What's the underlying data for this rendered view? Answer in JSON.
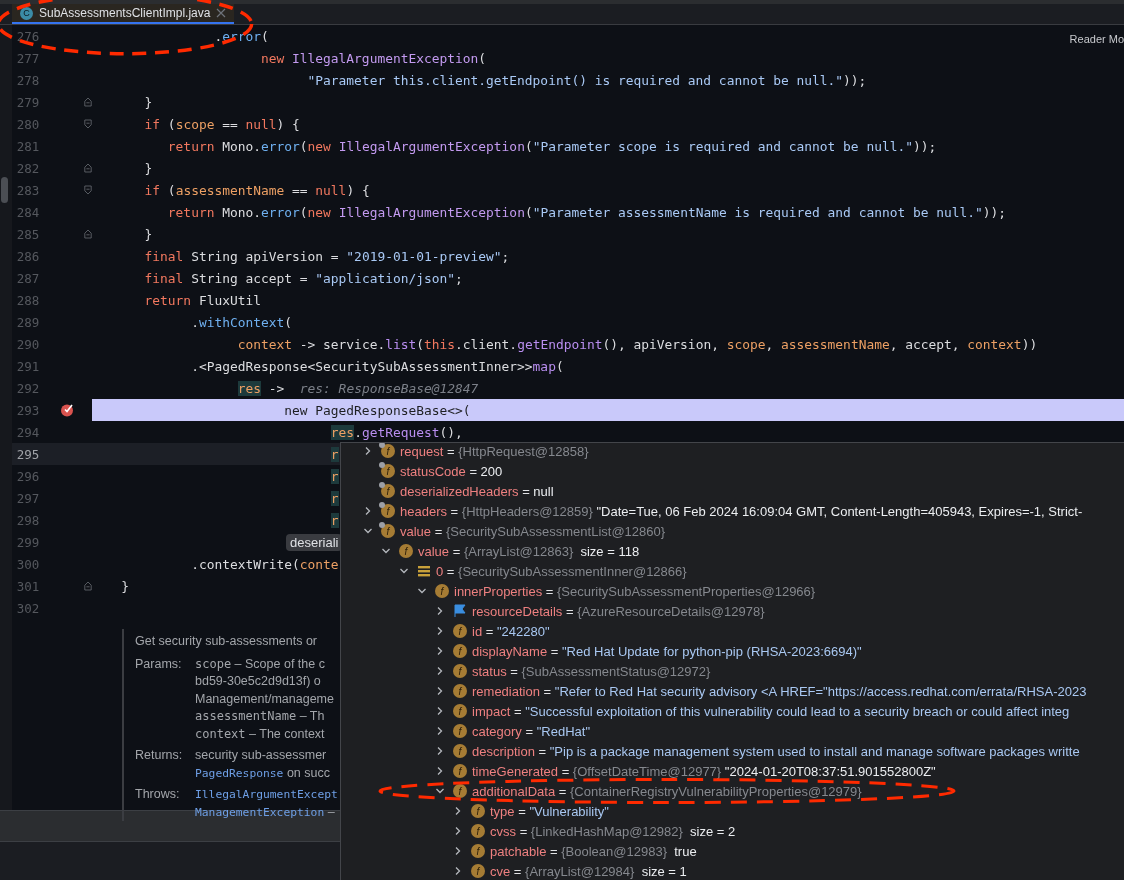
{
  "tab": {
    "label": "SubAssessmentsClientImpl.java",
    "icon": "C",
    "selected": true,
    "circled": true
  },
  "reader_mode": "Reader Mo",
  "lines": [
    {
      "n": "276",
      "kind": "plain",
      "tokens": [
        {
          "t": "               ."
        },
        {
          "t": "error",
          "kind": "fn"
        },
        {
          "t": "("
        }
      ],
      "breakpoint": false,
      "execution": false,
      "current": false
    },
    {
      "n": "277",
      "kind": "plain",
      "tokens": [
        {
          "t": "                     new",
          "kind": "kw"
        },
        {
          "t": " IllegalArgumentException",
          "kind": "type"
        },
        {
          "t": "("
        }
      ],
      "breakpoint": false,
      "execution": false,
      "current": false
    },
    {
      "n": "278",
      "kind": "plain",
      "tokens": [
        {
          "t": "                           \"Parameter this.client.getEndpoint() is required and cannot be null.\"",
          "kind": "str"
        },
        {
          "t": "));"
        }
      ],
      "breakpoint": false,
      "execution": false,
      "current": false
    },
    {
      "n": "279",
      "kind": "fold-end",
      "tokens": [
        {
          "t": "      }"
        }
      ],
      "breakpoint": false,
      "execution": false,
      "current": false
    },
    {
      "n": "280",
      "kind": "fold-start",
      "tokens": [
        {
          "t": "      if",
          "kind": "kw"
        },
        {
          "t": " ("
        },
        {
          "t": "scope",
          "kind": "param"
        },
        {
          "t": " == "
        },
        {
          "t": "null",
          "kind": "kw"
        },
        {
          "t": ") {"
        }
      ],
      "breakpoint": false,
      "execution": false,
      "current": false
    },
    {
      "n": "281",
      "kind": "plain",
      "tokens": [
        {
          "t": "         return",
          "kind": "kw"
        },
        {
          "t": " Mono."
        },
        {
          "t": "error",
          "kind": "fn"
        },
        {
          "t": "("
        },
        {
          "t": "new",
          "kind": "kw"
        },
        {
          "t": " IllegalArgumentException",
          "kind": "type"
        },
        {
          "t": "("
        },
        {
          "t": "\"Parameter scope is required and cannot be null.\"",
          "kind": "str"
        },
        {
          "t": "));"
        }
      ],
      "breakpoint": false,
      "execution": false,
      "current": false
    },
    {
      "n": "282",
      "kind": "fold-end",
      "tokens": [
        {
          "t": "      }"
        }
      ],
      "breakpoint": false,
      "execution": false,
      "current": false
    },
    {
      "n": "283",
      "kind": "fold-start",
      "tokens": [
        {
          "t": "      if",
          "kind": "kw"
        },
        {
          "t": " ("
        },
        {
          "t": "assessmentName",
          "kind": "param"
        },
        {
          "t": " == "
        },
        {
          "t": "null",
          "kind": "kw"
        },
        {
          "t": ") {"
        }
      ],
      "breakpoint": false,
      "execution": false,
      "current": false
    },
    {
      "n": "284",
      "kind": "plain",
      "tokens": [
        {
          "t": "         return",
          "kind": "kw"
        },
        {
          "t": " Mono."
        },
        {
          "t": "error",
          "kind": "fn"
        },
        {
          "t": "("
        },
        {
          "t": "new",
          "kind": "kw"
        },
        {
          "t": " IllegalArgumentException",
          "kind": "type"
        },
        {
          "t": "("
        },
        {
          "t": "\"Parameter assessmentName is required and cannot be null.\"",
          "kind": "str"
        },
        {
          "t": "));"
        }
      ],
      "breakpoint": false,
      "execution": false,
      "current": false
    },
    {
      "n": "285",
      "kind": "fold-end",
      "tokens": [
        {
          "t": "      }"
        }
      ],
      "breakpoint": false,
      "execution": false,
      "current": false
    },
    {
      "n": "286",
      "kind": "plain",
      "tokens": [
        {
          "t": "      final",
          "kind": "kw"
        },
        {
          "t": " String apiVersion = "
        },
        {
          "t": "\"2019-01-01-preview\"",
          "kind": "str"
        },
        {
          "t": ";"
        }
      ],
      "breakpoint": false,
      "execution": false,
      "current": false
    },
    {
      "n": "287",
      "kind": "plain",
      "tokens": [
        {
          "t": "      final",
          "kind": "kw"
        },
        {
          "t": " String accept = "
        },
        {
          "t": "\"application/json\"",
          "kind": "str"
        },
        {
          "t": ";"
        }
      ],
      "breakpoint": false,
      "execution": false,
      "current": false
    },
    {
      "n": "288",
      "kind": "plain",
      "tokens": [
        {
          "t": "      return",
          "kind": "kw"
        },
        {
          "t": " FluxUtil"
        }
      ],
      "breakpoint": false,
      "execution": false,
      "current": false
    },
    {
      "n": "289",
      "kind": "plain",
      "tokens": [
        {
          "t": "            ."
        },
        {
          "t": "withContext",
          "kind": "fn"
        },
        {
          "t": "("
        }
      ],
      "breakpoint": false,
      "execution": false,
      "current": false
    },
    {
      "n": "290",
      "kind": "plain",
      "tokens": [
        {
          "t": "                  context",
          "kind": "param"
        },
        {
          "t": " -> service."
        },
        {
          "t": "list",
          "kind": "fn2"
        },
        {
          "t": "("
        },
        {
          "t": "this",
          "kind": "kw"
        },
        {
          "t": ".client."
        },
        {
          "t": "getEndpoint",
          "kind": "fn2"
        },
        {
          "t": "(), apiVersion, "
        },
        {
          "t": "scope",
          "kind": "param"
        },
        {
          "t": ", "
        },
        {
          "t": "assessmentName",
          "kind": "param"
        },
        {
          "t": ", accept, "
        },
        {
          "t": "context",
          "kind": "param"
        },
        {
          "t": "))"
        }
      ],
      "breakpoint": false,
      "execution": false,
      "current": false
    },
    {
      "n": "291",
      "kind": "plain",
      "tokens": [
        {
          "t": "            .<PagedResponse<SecuritySubAssessmentInner>>"
        },
        {
          "t": "map",
          "kind": "fn2"
        },
        {
          "t": "("
        }
      ],
      "breakpoint": false,
      "execution": false,
      "current": false
    },
    {
      "n": "292",
      "kind": "plain",
      "tokens": [
        {
          "t": "                  res",
          "kind": "ref"
        },
        {
          "t": " ->  "
        },
        {
          "t": "res: ResponseBase@12847",
          "kind": "hint"
        }
      ],
      "breakpoint": false,
      "execution": false,
      "current": false
    },
    {
      "n": "293",
      "kind": "plain",
      "tokens": [
        {
          "t": "                        new PagedResponseBase<>("
        }
      ],
      "breakpoint": true,
      "execution": true,
      "current": false
    },
    {
      "n": "294",
      "kind": "plain",
      "tokens": [
        {
          "t": "                              res",
          "kind": "ref"
        },
        {
          "t": "."
        },
        {
          "t": "getRequest",
          "kind": "fn2"
        },
        {
          "t": "(),"
        }
      ],
      "breakpoint": false,
      "execution": false,
      "current": false
    },
    {
      "n": "295",
      "kind": "plain",
      "tokens": [
        {
          "t": "                              r",
          "kind": "ref"
        }
      ],
      "breakpoint": false,
      "execution": false,
      "current": true
    },
    {
      "n": "296",
      "kind": "plain",
      "tokens": [
        {
          "t": "                              r",
          "kind": "ref"
        }
      ],
      "breakpoint": false,
      "execution": false,
      "current": false
    },
    {
      "n": "297",
      "kind": "plain",
      "tokens": [
        {
          "t": "                              r",
          "kind": "ref"
        }
      ],
      "breakpoint": false,
      "execution": false,
      "current": false
    },
    {
      "n": "298",
      "kind": "plain",
      "tokens": [
        {
          "t": "                              r",
          "kind": "ref"
        }
      ],
      "breakpoint": false,
      "execution": false,
      "current": false
    },
    {
      "n": "299",
      "kind": "plain",
      "tokens": [
        {
          "t": "deseriali",
          "kind": "chip"
        }
      ],
      "breakpoint": false,
      "execution": false,
      "current": false
    },
    {
      "n": "300",
      "kind": "plain",
      "tokens": [
        {
          "t": "            .contextWrite("
        },
        {
          "t": "conte",
          "kind": "param"
        }
      ],
      "breakpoint": false,
      "execution": false,
      "current": false
    },
    {
      "n": "301",
      "kind": "fold-end",
      "tokens": [
        {
          "t": "   }"
        }
      ],
      "breakpoint": false,
      "execution": false,
      "current": false
    },
    {
      "n": "302",
      "kind": "plain",
      "breakpoint": false,
      "execution": false,
      "current": false
    }
  ],
  "doc": {
    "summary": "Get security sub-assessments or",
    "sections": [
      {
        "label": "Params:",
        "lines": [
          [
            {
              "t": "scope",
              "kind": "code"
            },
            {
              "t": " – Scope of the c"
            }
          ],
          [
            {
              "t": "bd59-30e5c2d9d13f) o"
            }
          ],
          [
            {
              "t": "Management/manageme"
            }
          ],
          [
            {
              "t": "assessmentName",
              "kind": "code"
            },
            {
              "t": " – Th"
            }
          ],
          [
            {
              "t": "context",
              "kind": "code"
            },
            {
              "t": " – The context"
            }
          ]
        ]
      },
      {
        "label": "Returns:",
        "lines": [
          [
            {
              "t": "security sub-assessmer"
            }
          ],
          [
            {
              "t": "PagedResponse",
              "kind": "link"
            },
            {
              "t": " on succ"
            }
          ]
        ]
      },
      {
        "label": "Throws:",
        "lines": [
          [
            {
              "t": "IllegalArgumentExcept",
              "kind": "link"
            }
          ],
          [
            {
              "t": "ManagementException",
              "kind": "link"
            },
            {
              "t": " –"
            }
          ]
        ]
      }
    ]
  },
  "debugger": {
    "rows": [
      {
        "kind": "field-static",
        "icon": "f",
        "name": "request",
        "op": "=",
        "ref": "{HttpRequest@12858}",
        "expandable": true,
        "expanded": false,
        "circled": false
      },
      {
        "kind": "field-static",
        "icon": "f",
        "name": "statusCode",
        "op": "=",
        "value": "200",
        "is_string": false,
        "circled": false
      },
      {
        "kind": "field-static",
        "icon": "f",
        "name": "deserializedHeaders",
        "op": "=",
        "value": "null",
        "is_string": false,
        "circled": false
      },
      {
        "kind": "field-static",
        "icon": "f",
        "name": "headers",
        "op": "=",
        "ref": "{HttpHeaders@12859}",
        "value": "\"Date=Tue, 06 Feb 2024 16:09:04 GMT, Content-Length=405943, Expires=-1, Strict-",
        "is_string": false,
        "expandable": true,
        "expanded": false,
        "circled": false
      },
      {
        "kind": "field-static",
        "icon": "f",
        "name": "value",
        "op": "=",
        "ref": "{SecuritySubAssessmentList@12860}",
        "expandable": true,
        "expanded": true,
        "circled": false,
        "children": [
          {
            "kind": "field",
            "icon": "f",
            "name": "value",
            "op": "=",
            "ref": "{ArrayList@12863}",
            "value": "size = 118",
            "is_string": false,
            "expandable": true,
            "expanded": true,
            "circled": false,
            "children": [
              {
                "kind": "element",
                "name": "0",
                "op": "=",
                "ref": "{SecuritySubAssessmentInner@12866}",
                "expandable": true,
                "expanded": true,
                "circled": false,
                "children": [
                  {
                    "kind": "field",
                    "icon": "f",
                    "name": "innerProperties",
                    "op": "=",
                    "ref": "{SecuritySubAssessmentProperties@12966}",
                    "expandable": true,
                    "expanded": true,
                    "circled": false,
                    "children": [
                      {
                        "kind": "flag",
                        "name": "resourceDetails",
                        "op": "=",
                        "ref": "{AzureResourceDetails@12978}",
                        "expandable": true,
                        "expanded": false,
                        "circled": false
                      },
                      {
                        "kind": "field",
                        "icon": "f",
                        "name": "id",
                        "op": "=",
                        "value": "\"242280\"",
                        "is_string": true,
                        "expandable": true,
                        "expanded": false,
                        "circled": false
                      },
                      {
                        "kind": "field",
                        "icon": "f",
                        "name": "displayName",
                        "op": "=",
                        "value": "\"Red Hat Update for python-pip (RHSA-2023:6694)\"",
                        "is_string": true,
                        "expandable": true,
                        "expanded": false,
                        "circled": false
                      },
                      {
                        "kind": "field",
                        "icon": "f",
                        "name": "status",
                        "op": "=",
                        "ref": "{SubAssessmentStatus@12972}",
                        "expandable": true,
                        "expanded": false,
                        "circled": false
                      },
                      {
                        "kind": "field",
                        "icon": "f",
                        "name": "remediation",
                        "op": "=",
                        "value": "\"Refer to Red Hat security advisory <A HREF=\"https://access.redhat.com/errata/RHSA-2023",
                        "is_string": true,
                        "expandable": true,
                        "expanded": false,
                        "circled": false
                      },
                      {
                        "kind": "field",
                        "icon": "f",
                        "name": "impact",
                        "op": "=",
                        "value": "\"Successful exploitation of this vulnerability could lead to a security breach or could affect integ",
                        "is_string": true,
                        "expandable": true,
                        "expanded": false,
                        "circled": false
                      },
                      {
                        "kind": "field",
                        "icon": "f",
                        "name": "category",
                        "op": "=",
                        "value": "\"RedHat\"",
                        "is_string": true,
                        "expandable": true,
                        "expanded": false,
                        "circled": false
                      },
                      {
                        "kind": "field",
                        "icon": "f",
                        "name": "description",
                        "op": "=",
                        "value": "\"Pip is a package management system used to install and manage software packages writte",
                        "is_string": true,
                        "expandable": true,
                        "expanded": false,
                        "circled": false
                      },
                      {
                        "kind": "field",
                        "icon": "f",
                        "name": "timeGenerated",
                        "op": "=",
                        "ref": "{OffsetDateTime@12977}",
                        "value": "\"2024-01-20T08:37:51.901552800Z\"",
                        "is_string": false,
                        "expandable": true,
                        "expanded": false,
                        "circled": false
                      },
                      {
                        "kind": "field",
                        "icon": "f",
                        "name": "additionalData",
                        "op": "=",
                        "ref": "{ContainerRegistryVulnerabilityProperties@12979}",
                        "expandable": true,
                        "expanded": true,
                        "circled": true,
                        "children": [
                          {
                            "kind": "field",
                            "icon": "f",
                            "name": "type",
                            "op": "=",
                            "value": "\"Vulnerability\"",
                            "is_string": true,
                            "expandable": true,
                            "expanded": false,
                            "circled": false
                          },
                          {
                            "kind": "field",
                            "icon": "f",
                            "name": "cvss",
                            "op": "=",
                            "ref": "{LinkedHashMap@12982}",
                            "value": "size = 2",
                            "is_string": false,
                            "expandable": true,
                            "expanded": false,
                            "circled": false
                          },
                          {
                            "kind": "field",
                            "icon": "f",
                            "name": "patchable",
                            "op": "=",
                            "ref": "{Boolean@12983}",
                            "value": "true",
                            "is_string": false,
                            "expandable": true,
                            "expanded": false,
                            "circled": false
                          },
                          {
                            "kind": "field",
                            "icon": "f",
                            "name": "cve",
                            "op": "=",
                            "ref": "{ArrayList@12984}",
                            "value": "size = 1",
                            "is_string": false,
                            "expandable": true,
                            "expanded": false,
                            "circled": false
                          }
                        ]
                      }
                    ]
                  }
                ]
              }
            ]
          }
        ]
      }
    ]
  }
}
